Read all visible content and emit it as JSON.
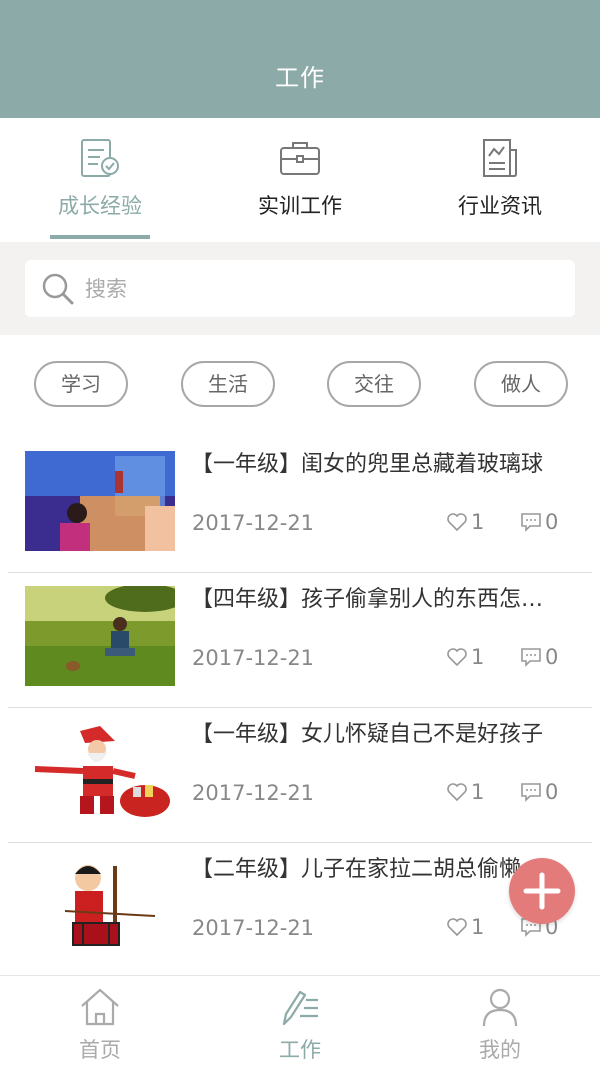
{
  "header": {
    "title": "工作"
  },
  "tabs": [
    {
      "label": "成长经验",
      "icon": "document-check-icon",
      "active": true
    },
    {
      "label": "实训工作",
      "icon": "briefcase-icon",
      "active": false
    },
    {
      "label": "行业资讯",
      "icon": "news-icon",
      "active": false
    }
  ],
  "search": {
    "placeholder": "搜索",
    "value": ""
  },
  "filters": [
    "学习",
    "生活",
    "交往",
    "做人"
  ],
  "articles": [
    {
      "title": "【一年级】闺女的兜里总藏着玻璃球",
      "date": "2017-12-21",
      "likes": "1",
      "comments": "0"
    },
    {
      "title": "【四年级】孩子偷拿别人的东西怎么办",
      "date": "2017-12-21",
      "likes": "1",
      "comments": "0"
    },
    {
      "title": "【一年级】女儿怀疑自己不是好孩子",
      "date": "2017-12-21",
      "likes": "1",
      "comments": "0"
    },
    {
      "title": "【二年级】儿子在家拉二胡总偷懒",
      "date": "2017-12-21",
      "likes": "1",
      "comments": "0"
    }
  ],
  "nav": [
    {
      "label": "首页",
      "icon": "home-icon",
      "active": false
    },
    {
      "label": "工作",
      "icon": "pen-list-icon",
      "active": true
    },
    {
      "label": "我的",
      "icon": "user-icon",
      "active": false
    }
  ],
  "colors": {
    "accent": "#8caaa8",
    "fab": "#e47b7b",
    "search_bg": "#f4f2f1"
  }
}
